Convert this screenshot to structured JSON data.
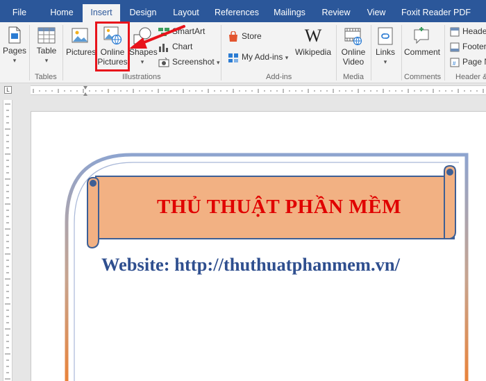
{
  "tabs": [
    {
      "label": "File",
      "active": false
    },
    {
      "label": "Home",
      "active": false
    },
    {
      "label": "Insert",
      "active": true
    },
    {
      "label": "Design",
      "active": false
    },
    {
      "label": "Layout",
      "active": false
    },
    {
      "label": "References",
      "active": false
    },
    {
      "label": "Mailings",
      "active": false
    },
    {
      "label": "Review",
      "active": false
    },
    {
      "label": "View",
      "active": false
    },
    {
      "label": "Foxit Reader PDF",
      "active": false
    }
  ],
  "ribbon": {
    "pages": "Pages",
    "table": "Table",
    "pictures": "Pictures",
    "online_pictures_line1": "Online",
    "online_pictures_line2": "Pictures",
    "shapes": "Shapes",
    "smartart": "SmartArt",
    "chart": "Chart",
    "screenshot": "Screenshot",
    "store": "Store",
    "my_addins": "My Add-ins",
    "wikipedia": "Wikipedia",
    "online_video_line1": "Online",
    "online_video_line2": "Video",
    "links": "Links",
    "comment": "Comment",
    "header": "Header",
    "footer": "Footer",
    "page_number": "Page N",
    "groups": {
      "tables": "Tables",
      "illustrations": "Illustrations",
      "addins": "Add-ins",
      "media": "Media",
      "comments": "Comments",
      "header_footer": "Header &"
    }
  },
  "document": {
    "banner_title": "THỦ THUẬT PHẦN MỀM",
    "website": "Website: http://thuthuatphanmem.vn/"
  },
  "colors": {
    "tabbar": "#2b579a",
    "highlight": "#e8131b",
    "banner_fill": "#f2b183",
    "banner_text": "#e00000",
    "website_text": "#2f4f8f"
  }
}
